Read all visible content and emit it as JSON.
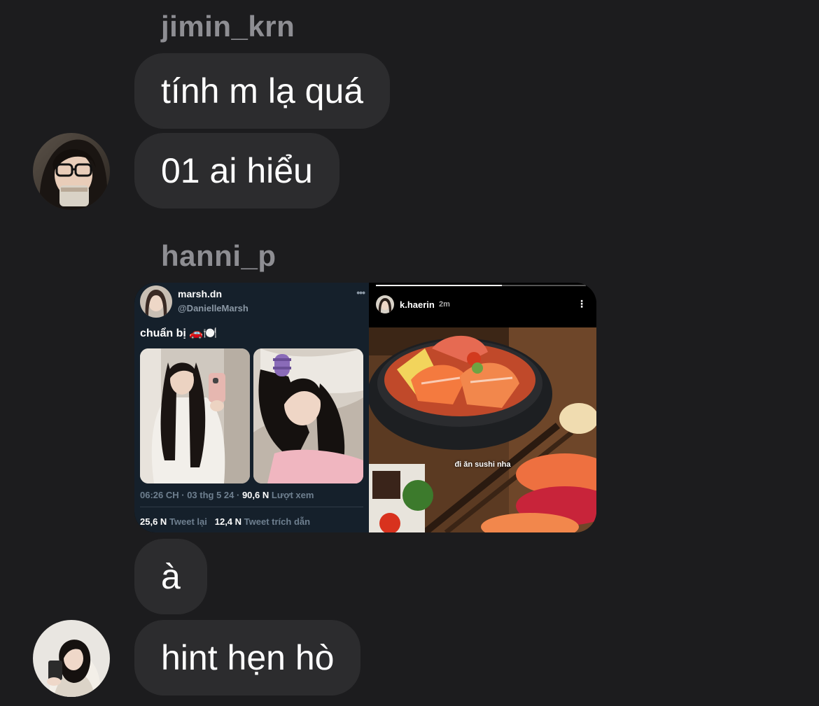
{
  "messages": [
    {
      "sender": "jimin_krn",
      "bubbles": [
        "tính m lạ quá",
        "01 ai hiểu"
      ]
    },
    {
      "sender": "hanni_p",
      "bubbles": [
        "à",
        "hint hẹn hò"
      ]
    }
  ],
  "tweet": {
    "name": "marsh.dn",
    "handle": "@DanielleMarsh",
    "more": "•••",
    "text": "chuẩn bị 🚗🍽️",
    "time": "06:26 CH · 03 thg 5 24 ·",
    "views_count": "90,6 N",
    "views_label": "Lượt xem",
    "retweets_count": "25,6 N",
    "retweets_label": "Tweet lại",
    "quotes_count": "12,4 N",
    "quotes_label": "Tweet trích dẫn"
  },
  "story": {
    "user": "k.haerin",
    "time": "2m",
    "more": "⋮",
    "caption": "đi ăn sushi nha"
  },
  "colors": {
    "background": "#1c1c1e",
    "bubble": "#2c2c2e",
    "sender_name": "#8e8e93",
    "tweet_bg": "#15202b"
  }
}
